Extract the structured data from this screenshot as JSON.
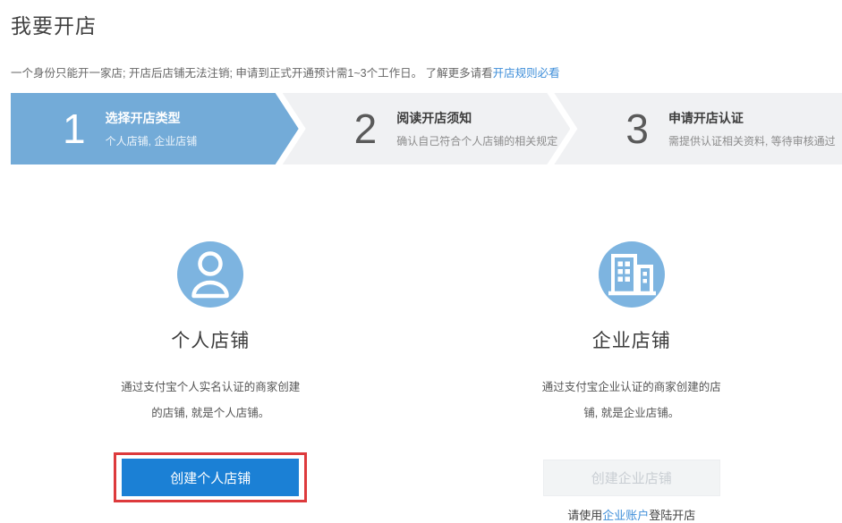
{
  "page": {
    "title": "我要开店",
    "intro_text": "一个身份只能开一家店; 开店后店铺无法注销; 申请到正式开通预计需1~3个工作日。 了解更多请看",
    "intro_link": "开店规则必看"
  },
  "steps": [
    {
      "number": "1",
      "title": "选择开店类型",
      "subtitle": "个人店铺, 企业店铺",
      "state": "active"
    },
    {
      "number": "2",
      "title": "阅读开店须知",
      "subtitle": "确认自己符合个人店铺的相关规定",
      "state": "upcoming"
    },
    {
      "number": "3",
      "title": "申请开店认证",
      "subtitle": "需提供认证相关资料, 等待审核通过",
      "state": "upcoming"
    }
  ],
  "options": [
    {
      "icon": "person-icon",
      "name": "个人店铺",
      "desc_line1": "通过支付宝个人实名认证的商家创建",
      "desc_line2": "的店铺, 就是个人店铺。",
      "button_label": "创建个人店铺",
      "button_state": "primary",
      "highlighted": true
    },
    {
      "icon": "building-icon",
      "name": "企业店铺",
      "desc_line1": "通过支付宝企业认证的商家创建的店",
      "desc_line2": "铺, 就是企业店铺。",
      "button_label": "创建企业店铺",
      "button_state": "disabled",
      "note_prefix": "请使用",
      "note_link": "企业账户",
      "note_suffix": "登陆开店"
    }
  ],
  "colors": {
    "step_active_bg": "#73abd8",
    "step_inactive_bg": "#f0f1f3",
    "icon_circle_bg": "#7db4e0",
    "primary_button_bg": "#1b80d5",
    "disabled_button_bg": "#f2f4f5",
    "link_blue": "#3e8ed9",
    "highlight_red": "#dd3a3c"
  }
}
